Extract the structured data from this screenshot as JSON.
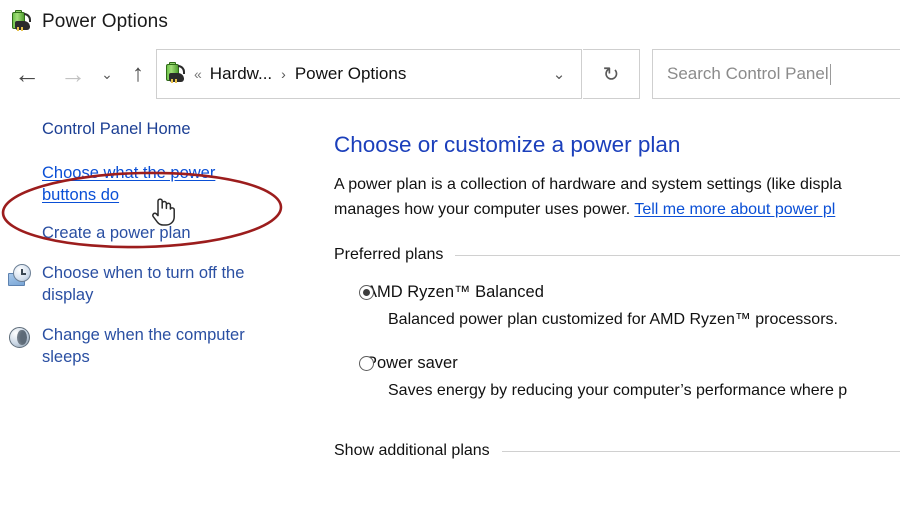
{
  "window": {
    "title": "Power Options",
    "app_icon": "power-plan-icon"
  },
  "toolbar": {
    "back_label": "←",
    "back_name": "back-button",
    "forward_label": "→",
    "recent_label": "⌄",
    "up_label": "↑",
    "refresh_label": "↻",
    "dropdown_label": "⌄"
  },
  "address_bar": {
    "root_chevron": "«",
    "crumbs": [
      {
        "label": "Hardw...",
        "truncated": true
      },
      {
        "label": "Power Options",
        "truncated": false
      }
    ],
    "separator": "›"
  },
  "search": {
    "placeholder": "Search Control Panel",
    "value": ""
  },
  "sidebar": {
    "items": [
      {
        "label": "Control Panel Home",
        "style": "home",
        "icon": null,
        "name": "sidebar-item-control-panel-home"
      },
      {
        "label": "Choose what the power buttons do",
        "style": "link",
        "icon": null,
        "name": "sidebar-item-choose-power-buttons"
      },
      {
        "label": "Create a power plan",
        "style": "plain",
        "icon": null,
        "name": "sidebar-item-create-power-plan"
      },
      {
        "label": "Choose when to turn off the display",
        "style": "plain",
        "icon": "display-clock-icon",
        "name": "sidebar-item-turn-off-display"
      },
      {
        "label": "Change when the computer sleeps",
        "style": "plain",
        "icon": "sleep-moon-icon",
        "name": "sidebar-item-computer-sleeps"
      }
    ]
  },
  "main": {
    "heading": "Choose or customize a power plan",
    "description_part1": "A power plan is a collection of hardware and system settings (like displa",
    "description_part2": "manages how your computer uses power. ",
    "description_link": "Tell me more about power pl",
    "preferred_plans_label": "Preferred plans",
    "show_additional_plans_label": "Show additional plans",
    "plans": [
      {
        "name": "AMD Ryzen™ Balanced",
        "description": "Balanced power plan customized for AMD Ryzen™ processors.",
        "selected": true
      },
      {
        "name": "Power saver",
        "description": "Saves energy by reducing your computer’s performance where p",
        "selected": false
      }
    ]
  },
  "annotation": {
    "type": "ellipse-highlight",
    "color": "#9c1d1d",
    "target": "Choose what the power buttons do"
  },
  "cursor": {
    "type": "pointing-hand"
  },
  "colors": {
    "heading_blue": "#1b3fbb",
    "link_blue": "#0a4fd6",
    "sidebar_navy": "#1c3f94",
    "annotation_red": "#9c1d1d",
    "border_gray": "#cfcfcf"
  }
}
